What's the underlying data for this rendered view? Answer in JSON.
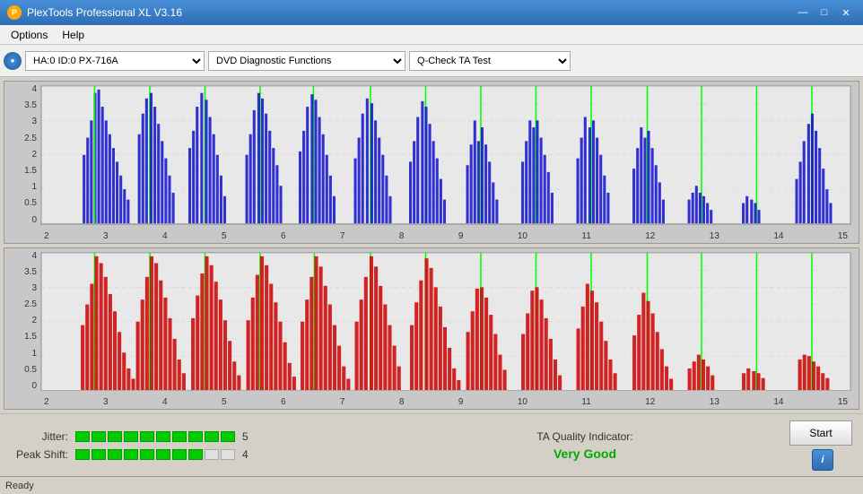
{
  "window": {
    "title": "PlexTools Professional XL V3.16",
    "icon": "P"
  },
  "titleControls": {
    "minimize": "—",
    "maximize": "□",
    "close": "✕"
  },
  "menu": {
    "items": [
      "Options",
      "Help"
    ]
  },
  "toolbar": {
    "deviceIcon": "●",
    "deviceLabel": "HA:0 ID:0  PX-716A",
    "functionOptions": [
      "DVD Diagnostic Functions"
    ],
    "functionSelected": "DVD Diagnostic Functions",
    "testOptions": [
      "Q-Check TA Test"
    ],
    "testSelected": "Q-Check TA Test"
  },
  "charts": {
    "topChart": {
      "yLabels": [
        "4",
        "3.5",
        "3",
        "2.5",
        "2",
        "1.5",
        "1",
        "0.5",
        "0"
      ],
      "xLabels": [
        "2",
        "3",
        "4",
        "5",
        "6",
        "7",
        "8",
        "9",
        "10",
        "11",
        "12",
        "13",
        "14",
        "15"
      ],
      "color": "blue",
      "title": "top-chart"
    },
    "bottomChart": {
      "yLabels": [
        "4",
        "3.5",
        "3",
        "2.5",
        "2",
        "1.5",
        "1",
        "0.5",
        "0"
      ],
      "xLabels": [
        "2",
        "3",
        "4",
        "5",
        "6",
        "7",
        "8",
        "9",
        "10",
        "11",
        "12",
        "13",
        "14",
        "15"
      ],
      "color": "red",
      "title": "bottom-chart"
    }
  },
  "metrics": {
    "jitter": {
      "label": "Jitter:",
      "segments": 10,
      "filled": 10,
      "value": "5"
    },
    "peakShift": {
      "label": "Peak Shift:",
      "segments": 10,
      "filled": 8,
      "value": "4"
    },
    "quality": {
      "label": "TA Quality Indicator:",
      "value": "Very Good"
    }
  },
  "buttons": {
    "start": "Start",
    "info": "i"
  },
  "status": {
    "text": "Ready"
  }
}
